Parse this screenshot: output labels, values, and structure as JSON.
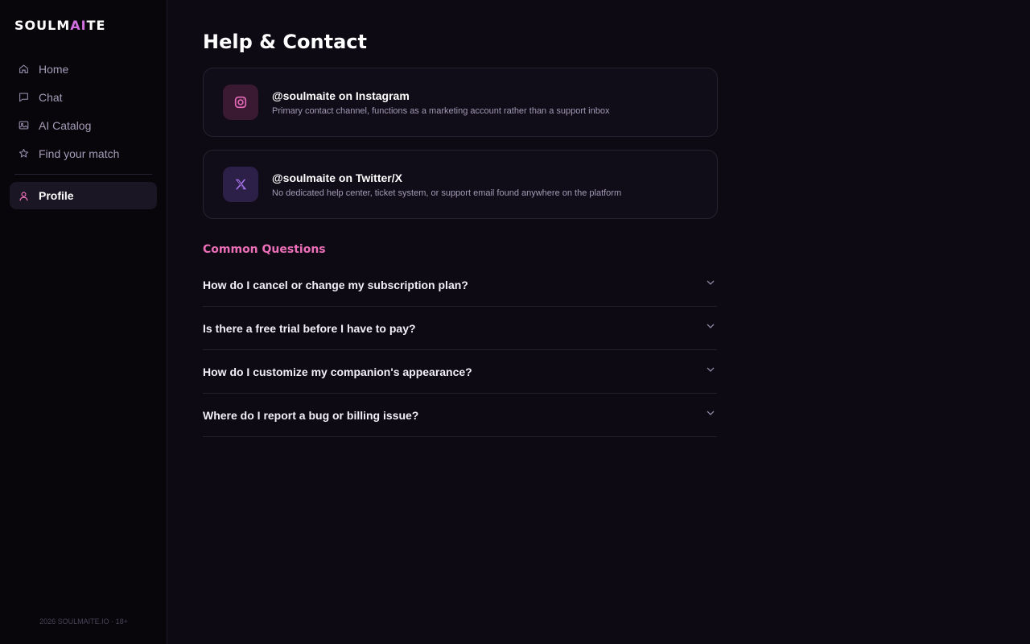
{
  "brand": {
    "logo_prefix": "SOULM",
    "logo_accent": "AI",
    "logo_suffix": "TE",
    "accent_color": "#d16fe0"
  },
  "sidebar": {
    "items": [
      {
        "label": "Home",
        "icon": "home-icon"
      },
      {
        "label": "Chat",
        "icon": "chat-icon"
      },
      {
        "label": "AI Catalog",
        "icon": "image-icon"
      },
      {
        "label": "Find your match",
        "icon": "star-icon"
      }
    ],
    "active_item": {
      "label": "Profile",
      "icon": "user-icon"
    },
    "footer": "2026 SOULMAITE.IO · 18+"
  },
  "page": {
    "title": "Help & Contact"
  },
  "contacts": [
    {
      "title": "@soulmaite on Instagram",
      "description": "Primary contact channel, functions as a marketing account rather than a support inbox",
      "icon": "instagram-icon",
      "icon_color": "#e76bb8"
    },
    {
      "title": "@soulmaite on Twitter/X",
      "description": "No dedicated help center, ticket system, or support email found anywhere on the platform",
      "icon": "x-twitter-icon",
      "icon_color": "#a774e8"
    }
  ],
  "faq": {
    "title": "Common Questions",
    "title_color": "#ec6fb8",
    "questions": [
      "How do I cancel or change my subscription plan?",
      "Is there a free trial before I have to pay?",
      "How do I customize my companion's appearance?",
      "Where do I report a bug or billing issue?"
    ]
  }
}
